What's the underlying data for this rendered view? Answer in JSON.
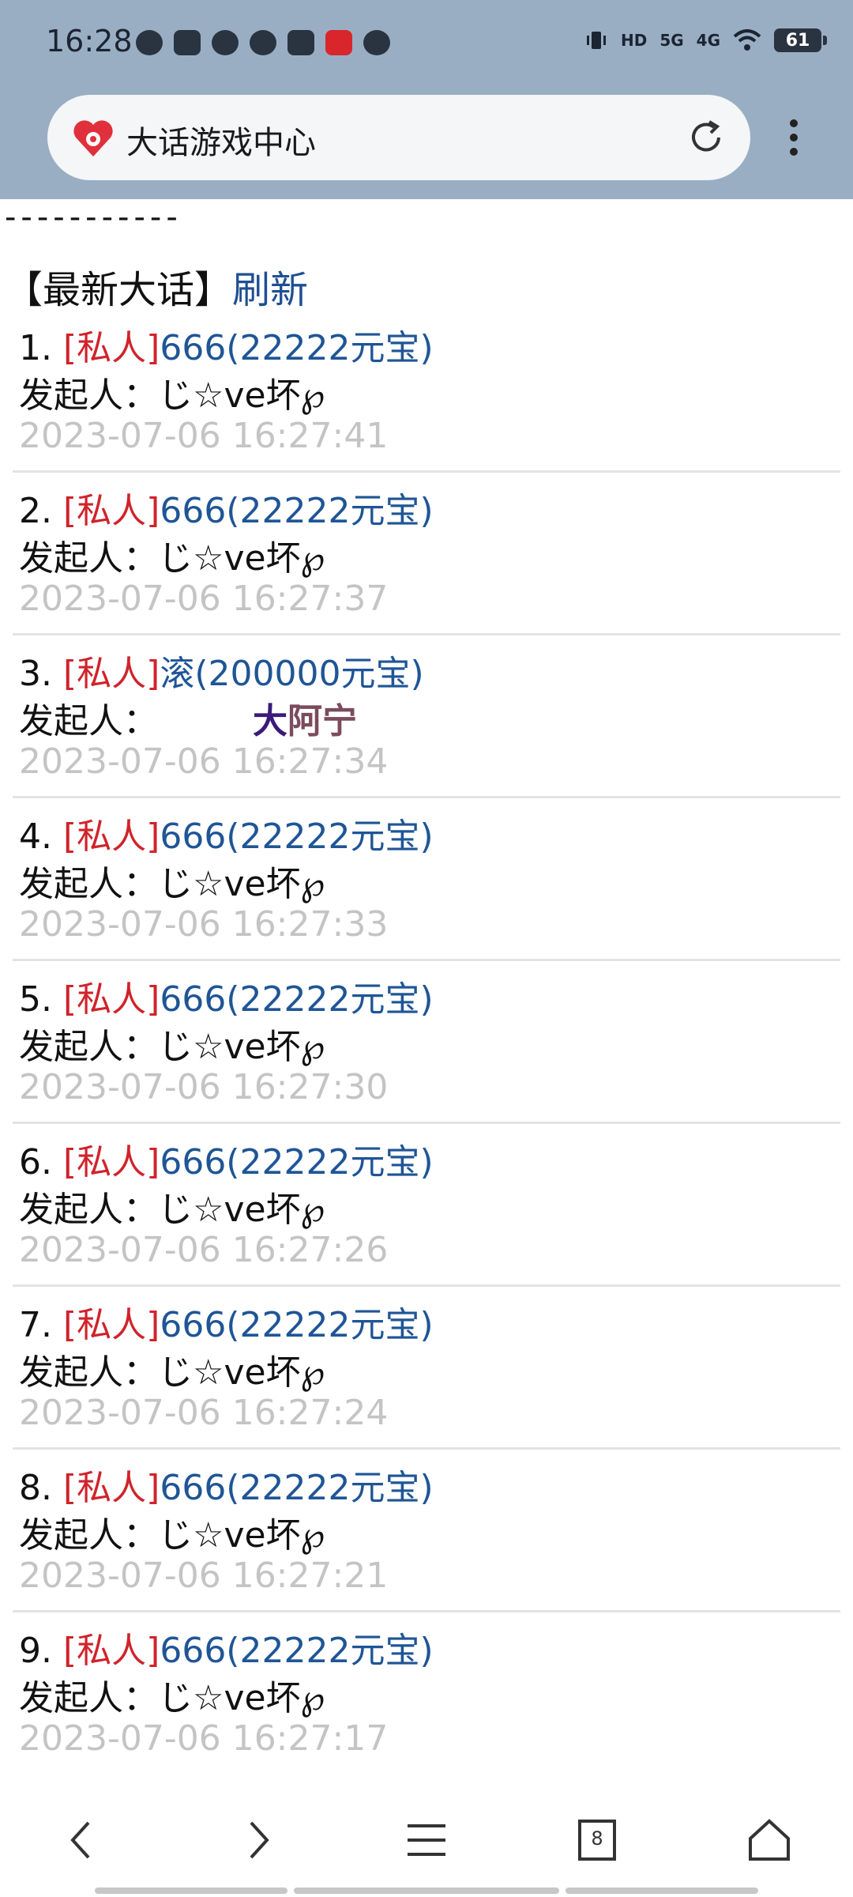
{
  "status_bar": {
    "time": "16:28",
    "battery": "61",
    "network_1": "HD",
    "network_2": "5G",
    "network_3": "4G"
  },
  "browser": {
    "site_title": "大话游戏中心",
    "tab_count": "8"
  },
  "page": {
    "separator": "-----------",
    "heading": "【最新大话】",
    "refresh_link": "刷新",
    "initiator_label": "发起人：",
    "items": [
      {
        "num": "1.",
        "tag": "[私人]",
        "message": "666(22222元宝)",
        "initiator": "じ☆ve坏℘",
        "time": "2023-07-06 16:27:41"
      },
      {
        "num": "2.",
        "tag": "[私人]",
        "message": "666(22222元宝)",
        "initiator": "じ☆ve坏℘",
        "time": "2023-07-06 16:27:37"
      },
      {
        "num": "3.",
        "tag": "[私人]",
        "message": "滚(200000元宝)",
        "initiator_part1": "大",
        "initiator_part2": "阿宁",
        "time": "2023-07-06 16:27:34"
      },
      {
        "num": "4.",
        "tag": "[私人]",
        "message": "666(22222元宝)",
        "initiator": "じ☆ve坏℘",
        "time": "2023-07-06 16:27:33"
      },
      {
        "num": "5.",
        "tag": "[私人]",
        "message": "666(22222元宝)",
        "initiator": "じ☆ve坏℘",
        "time": "2023-07-06 16:27:30"
      },
      {
        "num": "6.",
        "tag": "[私人]",
        "message": "666(22222元宝)",
        "initiator": "じ☆ve坏℘",
        "time": "2023-07-06 16:27:26"
      },
      {
        "num": "7.",
        "tag": "[私人]",
        "message": "666(22222元宝)",
        "initiator": "じ☆ve坏℘",
        "time": "2023-07-06 16:27:24"
      },
      {
        "num": "8.",
        "tag": "[私人]",
        "message": "666(22222元宝)",
        "initiator": "じ☆ve坏℘",
        "time": "2023-07-06 16:27:21"
      },
      {
        "num": "9.",
        "tag": "[私人]",
        "message": "666(22222元宝)",
        "initiator": "じ☆ve坏℘",
        "time": "2023-07-06 16:27:17"
      }
    ]
  },
  "colors": {
    "header_bg": "#9aaec3",
    "tag_red": "#d0232b",
    "link_blue": "#1f5596",
    "timestamp_gray": "#c4c4c4"
  },
  "icons": [
    "wechat-icon",
    "video-icon",
    "game-icon",
    "link-icon",
    "mail-icon",
    "netease-music-icon",
    "chat-icon",
    "vibrate-icon",
    "wifi-icon",
    "reload-icon",
    "more-icon",
    "back-icon",
    "forward-icon",
    "menu-icon",
    "tabs-icon",
    "home-icon"
  ]
}
